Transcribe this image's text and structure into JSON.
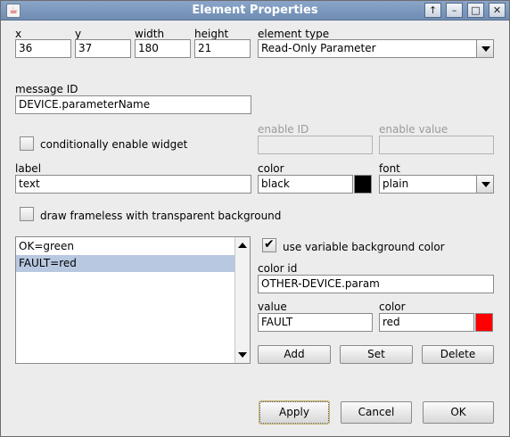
{
  "window": {
    "title": "Element Properties",
    "icon": "java-cup-icon"
  },
  "titlebar_buttons": {
    "up": "↑",
    "minimize": "–",
    "maximize": "□",
    "close": "✕"
  },
  "fields": {
    "x": {
      "label": "x",
      "value": "36"
    },
    "y": {
      "label": "y",
      "value": "37"
    },
    "width": {
      "label": "width",
      "value": "180"
    },
    "height": {
      "label": "height",
      "value": "21"
    },
    "element_type": {
      "label": "element type",
      "value": "Read-Only Parameter"
    },
    "message_id": {
      "label": "message ID",
      "value": "DEVICE.parameterName"
    },
    "enable_id": {
      "label": "enable ID",
      "value": ""
    },
    "enable_value": {
      "label": "enable value",
      "value": ""
    },
    "label": {
      "label": "label",
      "value": "text"
    },
    "color": {
      "label": "color",
      "value": "black",
      "swatch": "#000000"
    },
    "font": {
      "label": "font",
      "value": "plain"
    },
    "color_id": {
      "label": "color id",
      "value": "OTHER-DEVICE.param"
    },
    "value": {
      "label": "value",
      "value": "FAULT"
    },
    "value_color": {
      "label": "color",
      "value": "red",
      "swatch": "#ff0000"
    }
  },
  "checkboxes": {
    "conditionally_enable": {
      "label": "conditionally enable widget",
      "checked": false
    },
    "frameless": {
      "label": "draw frameless with transparent background",
      "checked": false
    },
    "variable_bg": {
      "label": "use variable background color",
      "checked": true,
      "tick": "✔"
    }
  },
  "color_list": {
    "items": [
      "OK=green",
      "FAULT=red"
    ],
    "selected_index": 1
  },
  "list_buttons": {
    "add": "Add",
    "set": "Set",
    "delete": "Delete"
  },
  "dialog_buttons": {
    "apply": "Apply",
    "cancel": "Cancel",
    "ok": "OK"
  },
  "colors": {
    "titlebar": "#7a96bd",
    "selection": "#b8c8e0"
  }
}
